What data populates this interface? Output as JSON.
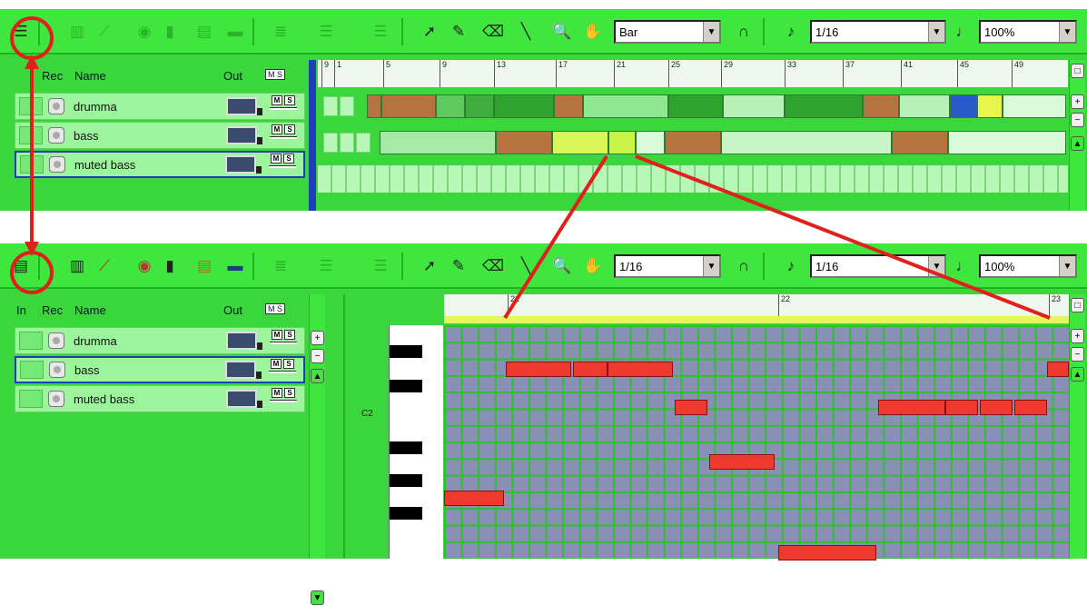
{
  "top": {
    "snap_value": "Bar",
    "grid_value": "1/16",
    "zoom_value": "100%",
    "headers": {
      "rec": "Rec",
      "name": "Name",
      "out": "Out",
      "ms": "M S"
    },
    "ruler": [
      "9",
      "1",
      "5",
      "9",
      "13",
      "17",
      "21",
      "25",
      "29",
      "33",
      "37",
      "41",
      "45",
      "49"
    ],
    "tracks": [
      {
        "name": "drumma"
      },
      {
        "name": "bass"
      },
      {
        "name": "muted bass"
      }
    ]
  },
  "bottom": {
    "snap_value": "1/16",
    "grid_value": "1/16",
    "zoom_value": "100%",
    "headers": {
      "in": "In",
      "rec": "Rec",
      "name": "Name",
      "out": "Out",
      "ms": "M S"
    },
    "ruler": [
      "21",
      "22",
      "23"
    ],
    "piano_label": "C2",
    "tracks": [
      {
        "name": "drumma"
      },
      {
        "name": "bass"
      },
      {
        "name": "muted bass"
      }
    ]
  },
  "colors": {
    "panel": "#3bd63b",
    "note": "#ee3a2e",
    "grid": "#8a8fb5",
    "annotation": "#e0201c"
  }
}
